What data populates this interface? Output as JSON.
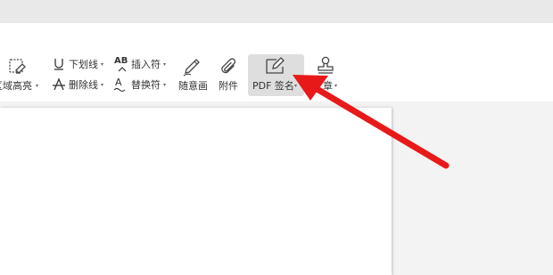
{
  "toolbar": {
    "region_highlight_label": "区域高亮",
    "underline_label": "下划线",
    "strikethrough_label": "删除线",
    "insert_char_label": "插入符",
    "replace_char_label": "替换符",
    "freehand_label": "随意画",
    "attachment_label": "附件",
    "pdf_sign_label": "PDF 签名",
    "stamp_label": "章",
    "caret": "▾",
    "ab_glyph": "AB",
    "a_glyph": "A"
  },
  "colors": {
    "arrow": "#e81919",
    "titlebar": "#e9e9e9",
    "ribbon": "#ffffff",
    "workspace": "#f3f3f3",
    "highlight": "#dedede"
  },
  "icons": [
    "highlight-icon",
    "underline-icon",
    "insert-char-icon",
    "strikethrough-icon",
    "replace-char-icon",
    "pencil-icon",
    "paperclip-icon",
    "pen-sign-icon",
    "stamp-icon"
  ]
}
